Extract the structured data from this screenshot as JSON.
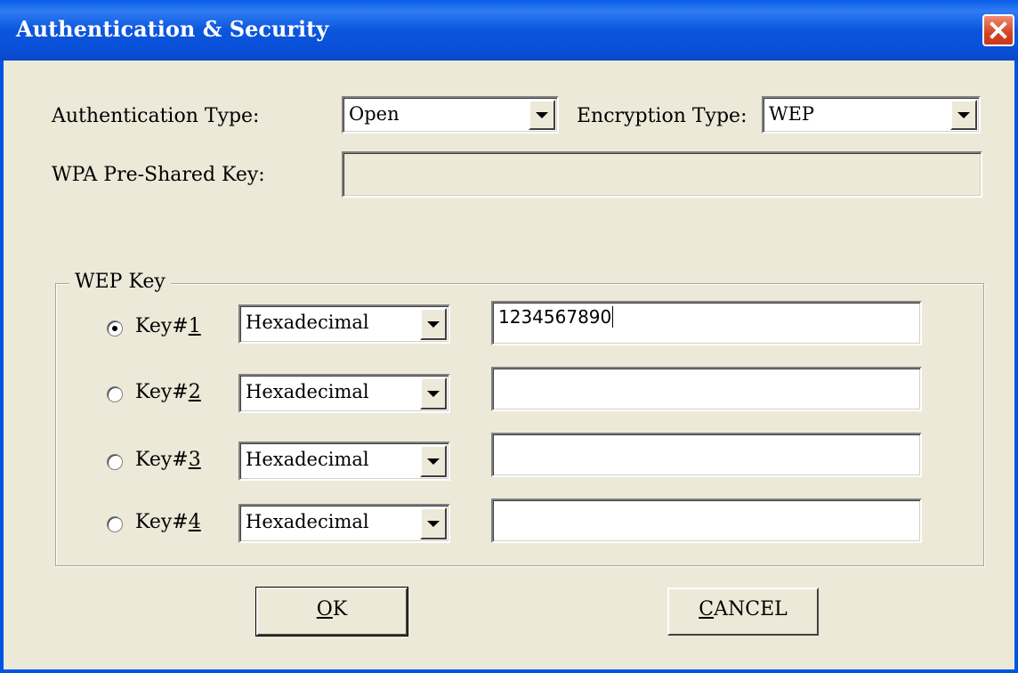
{
  "window": {
    "title": "Authentication & Security",
    "close_icon": "close-x-icon"
  },
  "auth": {
    "label": "Authentication Type:",
    "value": "Open"
  },
  "encryption": {
    "label": "Encryption Type:",
    "value": "WEP"
  },
  "wpa": {
    "label": "WPA Pre-Shared Key:",
    "value": ""
  },
  "wep_group": {
    "legend": "WEP Key",
    "keys": [
      {
        "label_prefix": "Key#",
        "label_num": "1",
        "format": "Hexadecimal",
        "value": "1234567890",
        "selected": true
      },
      {
        "label_prefix": "Key#",
        "label_num": "2",
        "format": "Hexadecimal",
        "value": "",
        "selected": false
      },
      {
        "label_prefix": "Key#",
        "label_num": "3",
        "format": "Hexadecimal",
        "value": "",
        "selected": false
      },
      {
        "label_prefix": "Key#",
        "label_num": "4",
        "format": "Hexadecimal",
        "value": "",
        "selected": false
      }
    ]
  },
  "buttons": {
    "ok_mnemonic": "O",
    "ok_rest": "K",
    "cancel_mnemonic": "C",
    "cancel_rest": "ANCEL"
  },
  "colors": {
    "titlebar": "#0a5ce6",
    "dialog_bg": "#ece9d8",
    "close_button": "#d44322"
  }
}
